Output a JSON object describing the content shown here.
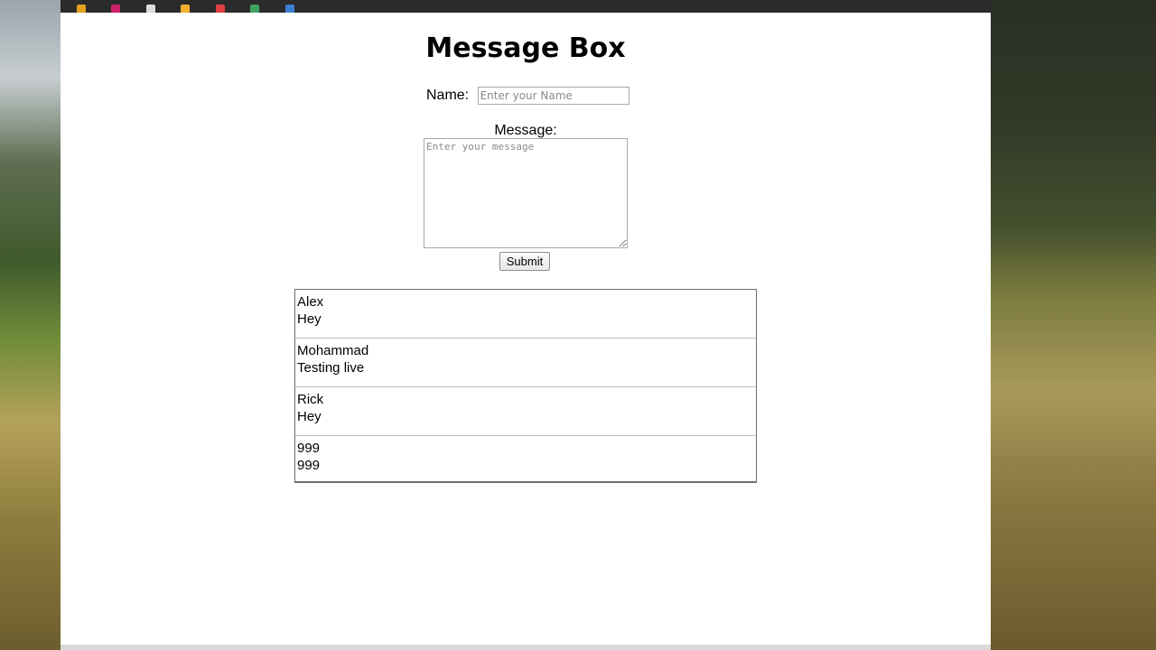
{
  "page": {
    "title": "Message Box"
  },
  "form": {
    "name_label": "Name:",
    "name_placeholder": "Enter your Name",
    "name_value": "",
    "message_label": "Message:",
    "message_placeholder": "Enter your message",
    "message_value": "",
    "submit_label": "Submit"
  },
  "messages": [
    {
      "name": "Alex",
      "text": "Hey"
    },
    {
      "name": "Mohammad",
      "text": "Testing live"
    },
    {
      "name": "Rick",
      "text": "Hey"
    },
    {
      "name": "999",
      "text": "999"
    }
  ],
  "colors": {
    "page_background": "#ffffff",
    "border": "#6e6e6e",
    "divider": "#bdbdbd"
  }
}
